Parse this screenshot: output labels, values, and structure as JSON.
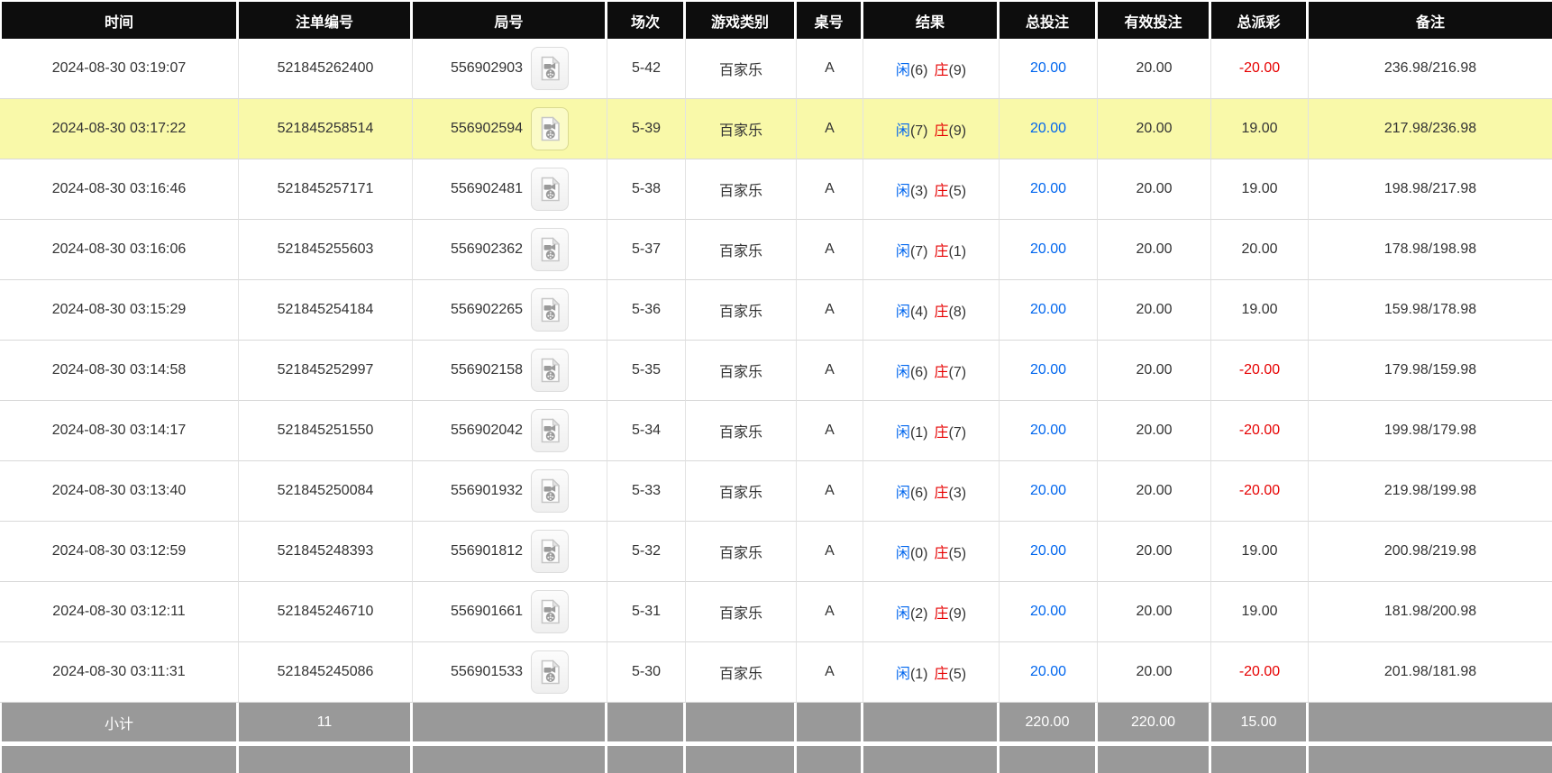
{
  "colors": {
    "header_bg": "#0d0d0d",
    "footer_bg": "#999999",
    "highlight_row": "#f9f9a9",
    "bet_blue": "#0066ee",
    "loss_red": "#e60000"
  },
  "icons": {
    "round_video_icon": "video-file"
  },
  "table": {
    "headers": [
      "时间",
      "注单编号",
      "局号",
      "场次",
      "游戏类别",
      "桌号",
      "结果",
      "总投注",
      "有效投注",
      "总派彩",
      "备注"
    ],
    "rows": [
      {
        "time": "2024-08-30 03:19:07",
        "bet_no": "521845262400",
        "round_no": "556902903",
        "session": "5-42",
        "game": "百家乐",
        "table_no": "A",
        "player_label": "闲",
        "player_score": "(6)",
        "banker_label": "庄",
        "banker_score": "(9)",
        "total_bet": "20.00",
        "valid_bet": "20.00",
        "payout": "-20.00",
        "remark": "236.98/216.98",
        "highlighted": false
      },
      {
        "time": "2024-08-30 03:17:22",
        "bet_no": "521845258514",
        "round_no": "556902594",
        "session": "5-39",
        "game": "百家乐",
        "table_no": "A",
        "player_label": "闲",
        "player_score": "(7)",
        "banker_label": "庄",
        "banker_score": "(9)",
        "total_bet": "20.00",
        "valid_bet": "20.00",
        "payout": "19.00",
        "remark": "217.98/236.98",
        "highlighted": true
      },
      {
        "time": "2024-08-30 03:16:46",
        "bet_no": "521845257171",
        "round_no": "556902481",
        "session": "5-38",
        "game": "百家乐",
        "table_no": "A",
        "player_label": "闲",
        "player_score": "(3)",
        "banker_label": "庄",
        "banker_score": "(5)",
        "total_bet": "20.00",
        "valid_bet": "20.00",
        "payout": "19.00",
        "remark": "198.98/217.98",
        "highlighted": false
      },
      {
        "time": "2024-08-30 03:16:06",
        "bet_no": "521845255603",
        "round_no": "556902362",
        "session": "5-37",
        "game": "百家乐",
        "table_no": "A",
        "player_label": "闲",
        "player_score": "(7)",
        "banker_label": "庄",
        "banker_score": "(1)",
        "total_bet": "20.00",
        "valid_bet": "20.00",
        "payout": "20.00",
        "remark": "178.98/198.98",
        "highlighted": false
      },
      {
        "time": "2024-08-30 03:15:29",
        "bet_no": "521845254184",
        "round_no": "556902265",
        "session": "5-36",
        "game": "百家乐",
        "table_no": "A",
        "player_label": "闲",
        "player_score": "(4)",
        "banker_label": "庄",
        "banker_score": "(8)",
        "total_bet": "20.00",
        "valid_bet": "20.00",
        "payout": "19.00",
        "remark": "159.98/178.98",
        "highlighted": false
      },
      {
        "time": "2024-08-30 03:14:58",
        "bet_no": "521845252997",
        "round_no": "556902158",
        "session": "5-35",
        "game": "百家乐",
        "table_no": "A",
        "player_label": "闲",
        "player_score": "(6)",
        "banker_label": "庄",
        "banker_score": "(7)",
        "total_bet": "20.00",
        "valid_bet": "20.00",
        "payout": "-20.00",
        "remark": "179.98/159.98",
        "highlighted": false
      },
      {
        "time": "2024-08-30 03:14:17",
        "bet_no": "521845251550",
        "round_no": "556902042",
        "session": "5-34",
        "game": "百家乐",
        "table_no": "A",
        "player_label": "闲",
        "player_score": "(1)",
        "banker_label": "庄",
        "banker_score": "(7)",
        "total_bet": "20.00",
        "valid_bet": "20.00",
        "payout": "-20.00",
        "remark": "199.98/179.98",
        "highlighted": false
      },
      {
        "time": "2024-08-30 03:13:40",
        "bet_no": "521845250084",
        "round_no": "556901932",
        "session": "5-33",
        "game": "百家乐",
        "table_no": "A",
        "player_label": "闲",
        "player_score": "(6)",
        "banker_label": "庄",
        "banker_score": "(3)",
        "total_bet": "20.00",
        "valid_bet": "20.00",
        "payout": "-20.00",
        "remark": "219.98/199.98",
        "highlighted": false
      },
      {
        "time": "2024-08-30 03:12:59",
        "bet_no": "521845248393",
        "round_no": "556901812",
        "session": "5-32",
        "game": "百家乐",
        "table_no": "A",
        "player_label": "闲",
        "player_score": "(0)",
        "banker_label": "庄",
        "banker_score": "(5)",
        "total_bet": "20.00",
        "valid_bet": "20.00",
        "payout": "19.00",
        "remark": "200.98/219.98",
        "highlighted": false
      },
      {
        "time": "2024-08-30 03:12:11",
        "bet_no": "521845246710",
        "round_no": "556901661",
        "session": "5-31",
        "game": "百家乐",
        "table_no": "A",
        "player_label": "闲",
        "player_score": "(2)",
        "banker_label": "庄",
        "banker_score": "(9)",
        "total_bet": "20.00",
        "valid_bet": "20.00",
        "payout": "19.00",
        "remark": "181.98/200.98",
        "highlighted": false
      },
      {
        "time": "2024-08-30 03:11:31",
        "bet_no": "521845245086",
        "round_no": "556901533",
        "session": "5-30",
        "game": "百家乐",
        "table_no": "A",
        "player_label": "闲",
        "player_score": "(1)",
        "banker_label": "庄",
        "banker_score": "(5)",
        "total_bet": "20.00",
        "valid_bet": "20.00",
        "payout": "-20.00",
        "remark": "201.98/181.98",
        "highlighted": false
      }
    ],
    "subtotal": {
      "label": "小计",
      "count": "11",
      "round_no": "",
      "session": "",
      "game": "",
      "table_no": "",
      "result": "",
      "total_bet": "220.00",
      "valid_bet": "220.00",
      "payout": "15.00",
      "remark": ""
    }
  }
}
